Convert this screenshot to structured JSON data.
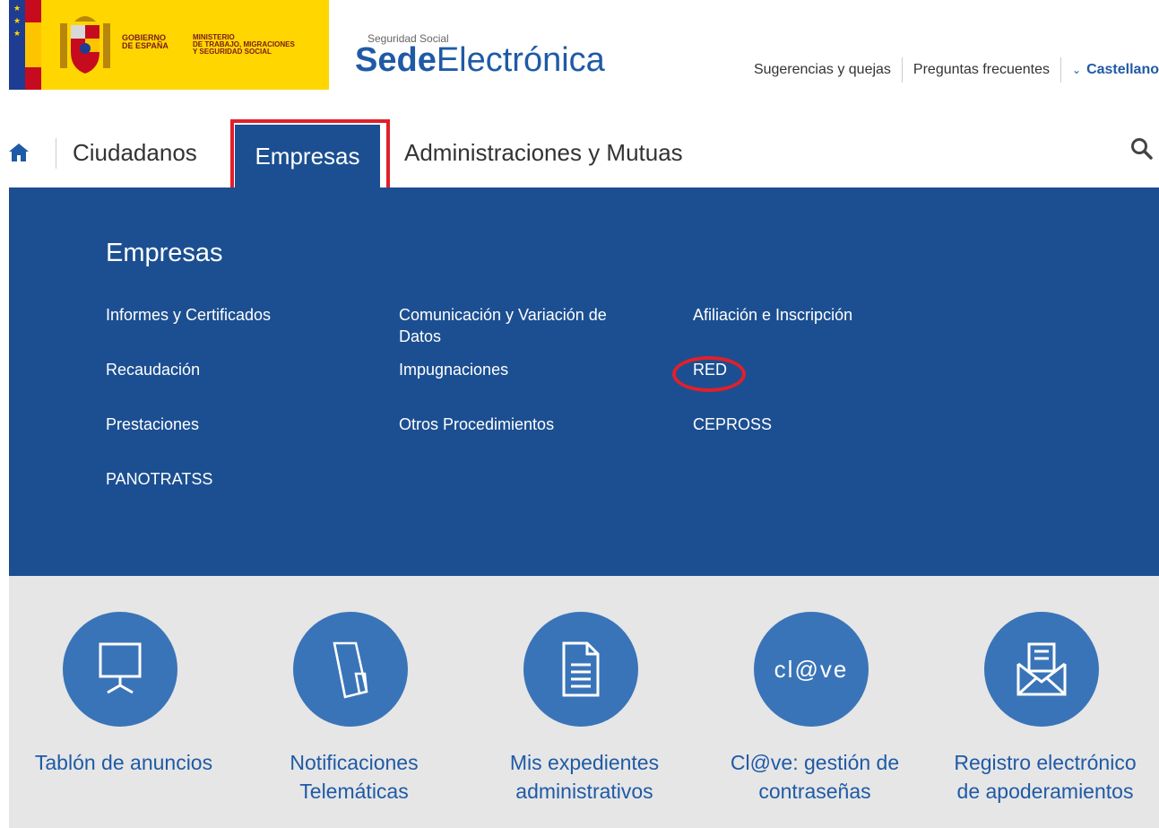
{
  "header": {
    "gov_line1": "GOBIERNO",
    "gov_line2": "DE ESPAÑA",
    "min_line1": "MINISTERIO",
    "min_line2": "DE TRABAJO, MIGRACIONES",
    "min_line3": "Y SEGURIDAD SOCIAL",
    "sede_small": "Seguridad Social",
    "sede_bold": "Sede",
    "sede_light": "Electrónica",
    "links": [
      "Sugerencias y quejas",
      "Preguntas frecuentes"
    ],
    "lang_chevron": "⌄",
    "language": "Castellano"
  },
  "nav": {
    "items": [
      "Ciudadanos",
      "Empresas",
      "Administraciones y Mutuas"
    ]
  },
  "mega": {
    "title": "Empresas",
    "col1": [
      "Informes y Certificados",
      "Recaudación",
      "Prestaciones",
      "PANOTRATSS"
    ],
    "col2_line1": "Comunicación y Variación de",
    "col2_line2": "Datos",
    "col2": [
      "Impugnaciones",
      "Otros Procedimientos"
    ],
    "col3": [
      "Afiliación e Inscripción",
      "RED",
      "CEPROSS"
    ]
  },
  "tiles": [
    {
      "line1": "Tablón de anuncios",
      "line2": ""
    },
    {
      "line1": "Notificaciones",
      "line2": "Telemáticas"
    },
    {
      "line1": "Mis expedientes",
      "line2": "administrativos"
    },
    {
      "line1": "Cl@ve: gestión de",
      "line2": "contraseñas"
    },
    {
      "line1": "Registro electrónico",
      "line2": "de apoderamientos"
    }
  ],
  "clave_logo_text": "cl@ve",
  "colors": {
    "nav_blue": "#1c4f91",
    "accent_blue": "#1f5aa6",
    "tile_circle": "#3a74b8",
    "highlight_red": "#e0202a",
    "gov_yellow": "#ffd600"
  }
}
